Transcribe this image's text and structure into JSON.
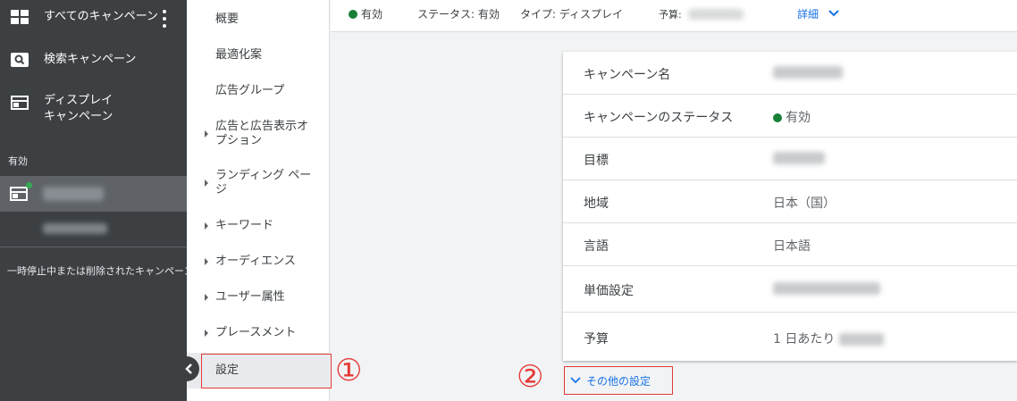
{
  "left_nav": {
    "all_campaigns": "すべてのキャンペーン",
    "search_campaigns": "検索キャンペーン",
    "display_campaigns_line1": "ディスプレイ",
    "display_campaigns_line2": "キャンペーン",
    "section_active": "有効",
    "paused_removed": "一時停止中または削除されたキャンペーン"
  },
  "sub_nav": {
    "items": [
      {
        "label": "概要"
      },
      {
        "label": "最適化案"
      },
      {
        "label": "広告グループ"
      },
      {
        "label_line1": "広告と広告表示オ",
        "label_line2": "プション"
      },
      {
        "label_line1": "ランディング ペー",
        "label_line2": "ジ"
      },
      {
        "label": "キーワード"
      },
      {
        "label": "オーディエンス"
      },
      {
        "label": "ユーザー属性"
      },
      {
        "label": "プレースメント"
      },
      {
        "label": "設定"
      }
    ]
  },
  "status_bar": {
    "state": "有効",
    "status": "ステータス: 有効",
    "type": "タイプ: ディスプレイ",
    "budget_label": "予算:",
    "detail_link": "詳細"
  },
  "settings": {
    "rows": [
      {
        "label": "キャンペーン名",
        "value": ""
      },
      {
        "label": "キャンペーンのステータス",
        "value": "有効"
      },
      {
        "label": "目標",
        "value": ""
      },
      {
        "label": "地域",
        "value": "日本（国）"
      },
      {
        "label": "言語",
        "value": "日本語"
      },
      {
        "label": "単価設定",
        "value": ""
      },
      {
        "label": "予算",
        "value": "1 日あたり"
      }
    ]
  },
  "other_settings": {
    "label": "その他の設定"
  },
  "annotations": {
    "one": "①",
    "two": "②"
  },
  "colors": {
    "active_green": "#188038",
    "link_blue": "#1a73e8",
    "annotation_red": "#e53935",
    "nav_dark": "#3c4043"
  }
}
